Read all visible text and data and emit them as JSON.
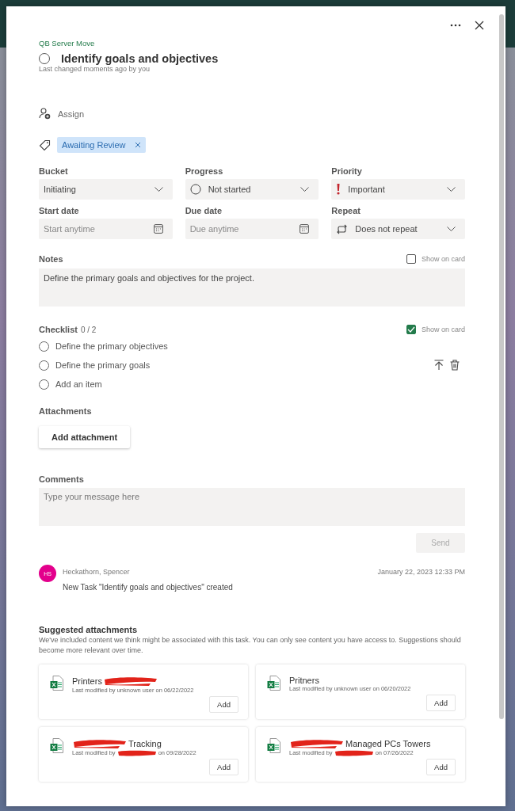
{
  "plan": "QB Server Move",
  "task": {
    "title": "Identify goals and objectives",
    "completed": false,
    "last_changed": "Last changed moments ago by you"
  },
  "assign": {
    "label": "Assign"
  },
  "labels": [
    {
      "text": "Awaiting Review"
    }
  ],
  "fields": [
    {
      "label": "Bucket",
      "kind": "dropdown",
      "value": "Initiating"
    },
    {
      "label": "Progress",
      "kind": "progress",
      "value": "Not started"
    },
    {
      "label": "Priority",
      "kind": "priority",
      "value": "Important"
    },
    {
      "label": "Start date",
      "kind": "date",
      "placeholder": "Start anytime"
    },
    {
      "label": "Due date",
      "kind": "date",
      "placeholder": "Due anytime"
    },
    {
      "label": "Repeat",
      "kind": "repeat",
      "value": "Does not repeat"
    }
  ],
  "notes": {
    "label": "Notes",
    "show_on_card": false,
    "show_on_card_label": "Show on card",
    "value": "Define the primary goals and objectives for the project."
  },
  "checklist": {
    "label": "Checklist",
    "count": "0 / 2",
    "show_on_card": true,
    "show_on_card_label": "Show on card",
    "add_placeholder": "Add an item",
    "items": [
      {
        "text": "Define the primary objectives",
        "checked": false,
        "hovered": false
      },
      {
        "text": "Define the primary goals",
        "checked": false,
        "hovered": true
      }
    ]
  },
  "attachments": {
    "label": "Attachments",
    "button": "Add attachment"
  },
  "comments": {
    "label": "Comments",
    "placeholder": "Type your message here",
    "send": "Send",
    "send_disabled": true
  },
  "activity": [
    {
      "initials": "HS",
      "color": "#e3008c",
      "author": "Heckathorn, Spencer",
      "time": "January 22, 2023 12:33 PM",
      "text": "New Task \"Identify goals and objectives\" created"
    }
  ],
  "suggested": {
    "title": "Suggested attachments",
    "description": "We've included content we think might be associated with this task. You can only see content you have access to. Suggestions should become more relevant over time.",
    "items": [
      {
        "name": [
          {
            "kind": "text",
            "text": "Printers"
          },
          {
            "kind": "redaction"
          }
        ],
        "meta": [
          {
            "kind": "text",
            "text": "Last modified by unknown user on 06/22/2022"
          }
        ],
        "button": "Add"
      },
      {
        "name": [
          {
            "kind": "text",
            "text": "Pritners"
          }
        ],
        "meta": [
          {
            "kind": "text",
            "text": "Last modified by unknown user on 06/20/2022"
          }
        ],
        "button": "Add"
      },
      {
        "name": [
          {
            "kind": "redaction"
          },
          {
            "kind": "text",
            "text": "Tracking"
          }
        ],
        "meta": [
          {
            "kind": "text",
            "text": "Last modified by"
          },
          {
            "kind": "redaction"
          },
          {
            "kind": "text",
            "text": "on 09/28/2022"
          }
        ],
        "button": "Add"
      },
      {
        "name": [
          {
            "kind": "redaction"
          },
          {
            "kind": "text",
            "text": "Managed PCs Towers"
          }
        ],
        "meta": [
          {
            "kind": "text",
            "text": "Last modified by"
          },
          {
            "kind": "redaction"
          },
          {
            "kind": "text",
            "text": "on 07/26/2022"
          }
        ],
        "button": "Add"
      }
    ]
  }
}
